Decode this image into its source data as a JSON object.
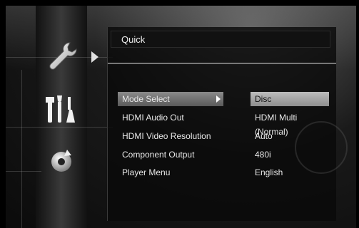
{
  "panel": {
    "title": "Quick"
  },
  "categories": [
    {
      "icon": "wrench-icon",
      "selected": true
    },
    {
      "icon": "tools-icon",
      "selected": false
    },
    {
      "icon": "refresh-disc-icon",
      "selected": false
    }
  ],
  "settings": [
    {
      "label": "Mode Select",
      "value": "Disc",
      "selected": true
    },
    {
      "label": "HDMI Audio Out",
      "value": "HDMI Multi (Normal)",
      "selected": false
    },
    {
      "label": "HDMI Video Resolution",
      "value": "Auto",
      "selected": false
    },
    {
      "label": "Component Output",
      "value": "480i",
      "selected": false
    },
    {
      "label": "Player Menu",
      "value": "English",
      "selected": false
    }
  ]
}
